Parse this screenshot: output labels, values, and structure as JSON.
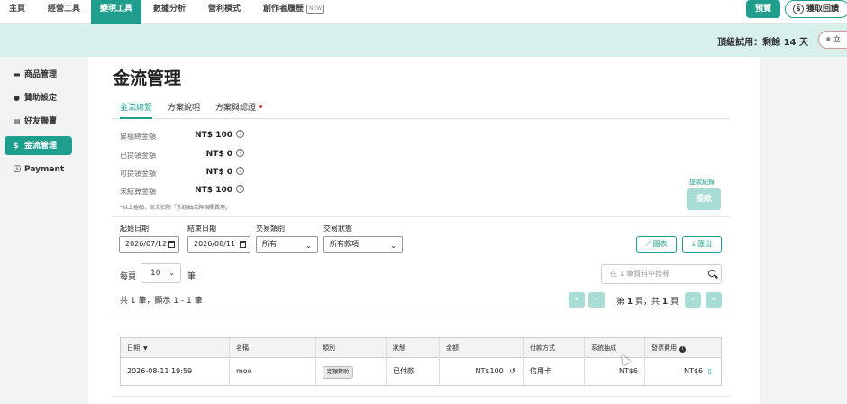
{
  "topnav": {
    "items": [
      {
        "label": "主頁"
      },
      {
        "label": "經營工具"
      },
      {
        "label": "變現工具",
        "active": true
      },
      {
        "label": "數據分析"
      },
      {
        "label": "營利模式"
      },
      {
        "label": "創作者履歷",
        "badge": "NEW"
      }
    ],
    "preview_label": "預覽",
    "feedback_label": "獲取回饋",
    "feedback_icon": "dollar-circle-icon"
  },
  "trial": {
    "text": "頂級試用：剩餘 14 天",
    "button_label": "立"
  },
  "sidebar": {
    "items": [
      {
        "label": "商品管理",
        "icon": "cart-icon"
      },
      {
        "label": "贊助設定",
        "icon": "sponsor-icon"
      },
      {
        "label": "好友聯賣",
        "icon": "cards-icon"
      },
      {
        "label": "金流管理",
        "icon": "dollar-icon",
        "active": true
      },
      {
        "label": "Payment",
        "icon": "info-icon"
      }
    ]
  },
  "page": {
    "title": "金流管理",
    "tabs": [
      {
        "label": "金流總覽",
        "active": true
      },
      {
        "label": "方案說明"
      },
      {
        "label": "方案與認證",
        "has_dot": true
      }
    ],
    "summary": [
      {
        "label": "累積總金額",
        "value": "NT$ 100"
      },
      {
        "label": "已提領金額",
        "value": "NT$ 0"
      },
      {
        "label": "可提領金額",
        "value": "NT$ 0"
      },
      {
        "label": "未結算金額",
        "value": "NT$ 100"
      }
    ],
    "note": "*以上金額，尚未扣除「系統抽成與相關費用」",
    "history_link": "提款紀錄",
    "withdraw_label": "提款"
  },
  "filters": {
    "start_label": "起始日期",
    "start_value": "2026/07/12",
    "end_label": "結束日期",
    "end_value": "2026/08/11",
    "type_label": "交易類別",
    "type_value": "所有",
    "status_label": "交易狀態",
    "status_value": "所有款項",
    "chart_label": "圖表",
    "export_label": "匯出"
  },
  "list": {
    "perpage_label": "每頁",
    "perpage_value": "10",
    "perpage_unit": "筆",
    "search_placeholder": "在 1 筆資料中搜尋",
    "result_text": "共 1 筆，顯示 1 - 1 筆",
    "page_prefix": "第",
    "page_current": "1",
    "page_mid": "頁，共",
    "page_total": "1",
    "page_suffix": "頁",
    "first_label": "«",
    "prev_label": "‹",
    "next_label": "›",
    "last_label": "»"
  },
  "table": {
    "headers": [
      "日期",
      "名稱",
      "類別",
      "狀態",
      "金額",
      "付款方式",
      "系統抽成",
      "發票費用"
    ],
    "row": {
      "date": "2026-08-11 19:59",
      "name": "moo",
      "category": "定額贊助",
      "status": "已付款",
      "amount": "NT$100",
      "method": "信用卡",
      "fee": "NT$6",
      "invoice": "NT$6"
    }
  },
  "colors": {
    "accent": "#1f9e8e",
    "accent_light": "#a8ddd6",
    "trial_bg": "#d7f0eb"
  }
}
